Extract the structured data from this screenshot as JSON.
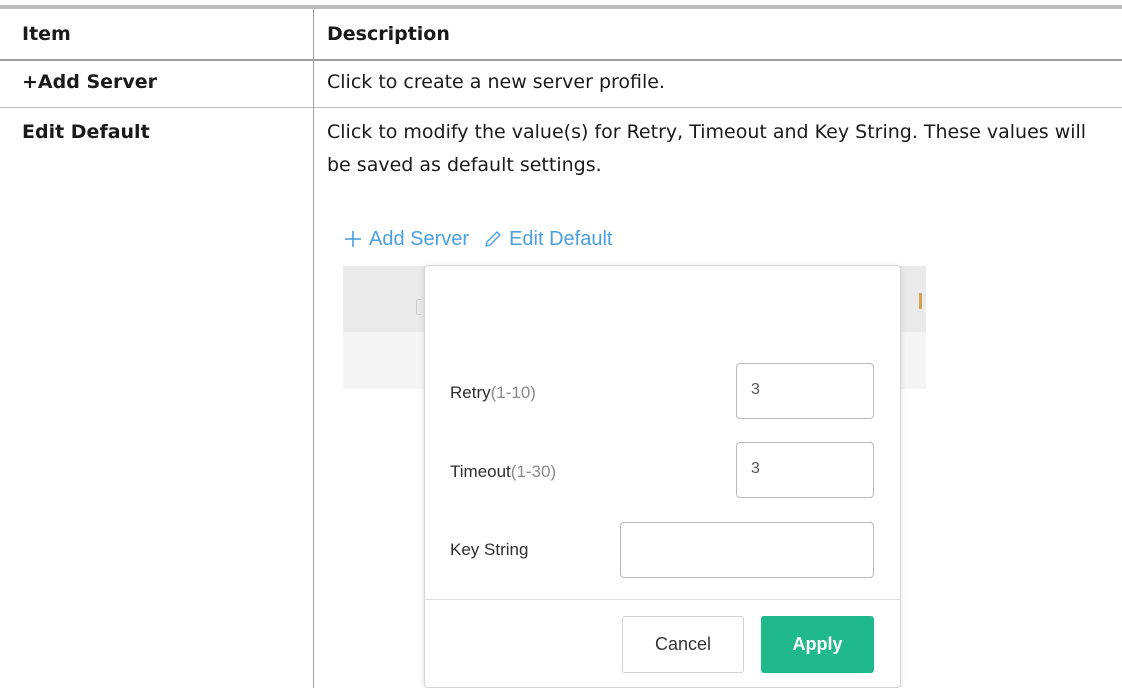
{
  "table": {
    "header": {
      "item": "Item",
      "description": "Description"
    },
    "rows": [
      {
        "item": "+Add Server",
        "description": "Click to create a new server profile."
      },
      {
        "item": "Edit Default",
        "description": "Click to modify the value(s) for Retry, Timeout and Key String. These values will be saved as default settings."
      }
    ]
  },
  "illustration": {
    "toolbar": {
      "add_server_label": "Add Server",
      "add_server_icon": "plus-icon",
      "edit_default_label": "Edit Default",
      "edit_default_icon": "pencil-icon",
      "link_color": "#4a9fe0"
    },
    "dialog": {
      "retry": {
        "label": "Retry",
        "range": "(1-10)",
        "value": "3"
      },
      "timeout": {
        "label": "Timeout",
        "range": "(1-30)",
        "value": "3"
      },
      "key_string": {
        "label": "Key String",
        "value": ""
      },
      "cancel_label": "Cancel",
      "apply_label": "Apply",
      "apply_color": "#1fb98a"
    }
  }
}
